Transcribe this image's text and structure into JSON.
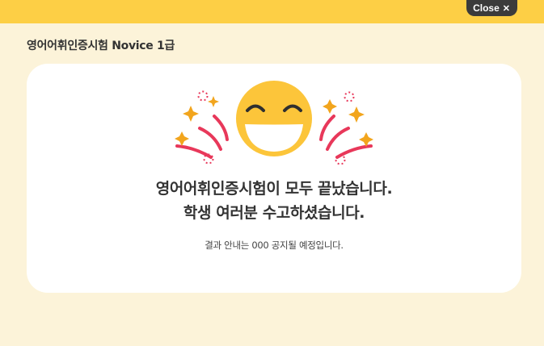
{
  "topbar": {
    "close_label": "Close",
    "close_icon": "close-x-icon"
  },
  "page": {
    "title": "영어어휘인증시험 Novice 1급"
  },
  "modal": {
    "headline_line1": "영어어휘인증시험이 모두 끝났습니다.",
    "headline_line2": "학생 여러분 수고하셨습니다.",
    "notice": "결과 안내는 000 공지될 예정입니다.",
    "illustration_icon": "laughing-emoji-icon"
  },
  "colors": {
    "topbar": "#fdcf45",
    "background": "#fcf3d9",
    "card": "#ffffff",
    "emoji": "#fcc53a",
    "sparkle_lines": "#e8385a",
    "sparkle_stars": "#f2a51d",
    "close_button": "#3b3b3b"
  }
}
